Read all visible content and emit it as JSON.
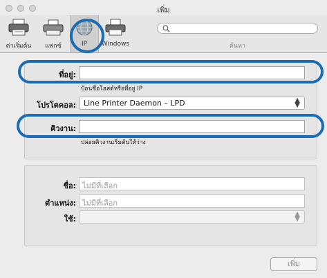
{
  "window": {
    "title": "เพิ่ม"
  },
  "toolbar": {
    "items": [
      {
        "label": "ค่าเริ่มต้น",
        "icon": "printer-icon"
      },
      {
        "label": "แฟกซ์",
        "icon": "fax-printer-icon"
      },
      {
        "label": "IP",
        "icon": "globe-icon"
      },
      {
        "label": "Windows",
        "icon": "windows-printer-icon"
      }
    ],
    "search": {
      "label": "ค้นหา",
      "placeholder": ""
    }
  },
  "form": {
    "address": {
      "label": "ที่อยู่:",
      "value": "",
      "hint": "ป้อนชื่อโฮสต์หรือที่อยู่ IP"
    },
    "protocol": {
      "label": "โปรโตคอล:",
      "value": "Line Printer Daemon – LPD"
    },
    "queue": {
      "label": "คิวงาน:",
      "value": "",
      "hint": "ปล่อยคิวงานเริ่มต้นให้ว่าง"
    }
  },
  "details": {
    "name": {
      "label": "ชื่อ:",
      "placeholder": "ไม่มีที่เลือก"
    },
    "location": {
      "label": "ตำแหน่ง:",
      "placeholder": "ไม่มีที่เลือก"
    },
    "use": {
      "label": "ใช้:",
      "value": ""
    }
  },
  "actions": {
    "add": "เพิ่ม"
  },
  "colors": {
    "highlight_ring": "#1a6cb5"
  }
}
